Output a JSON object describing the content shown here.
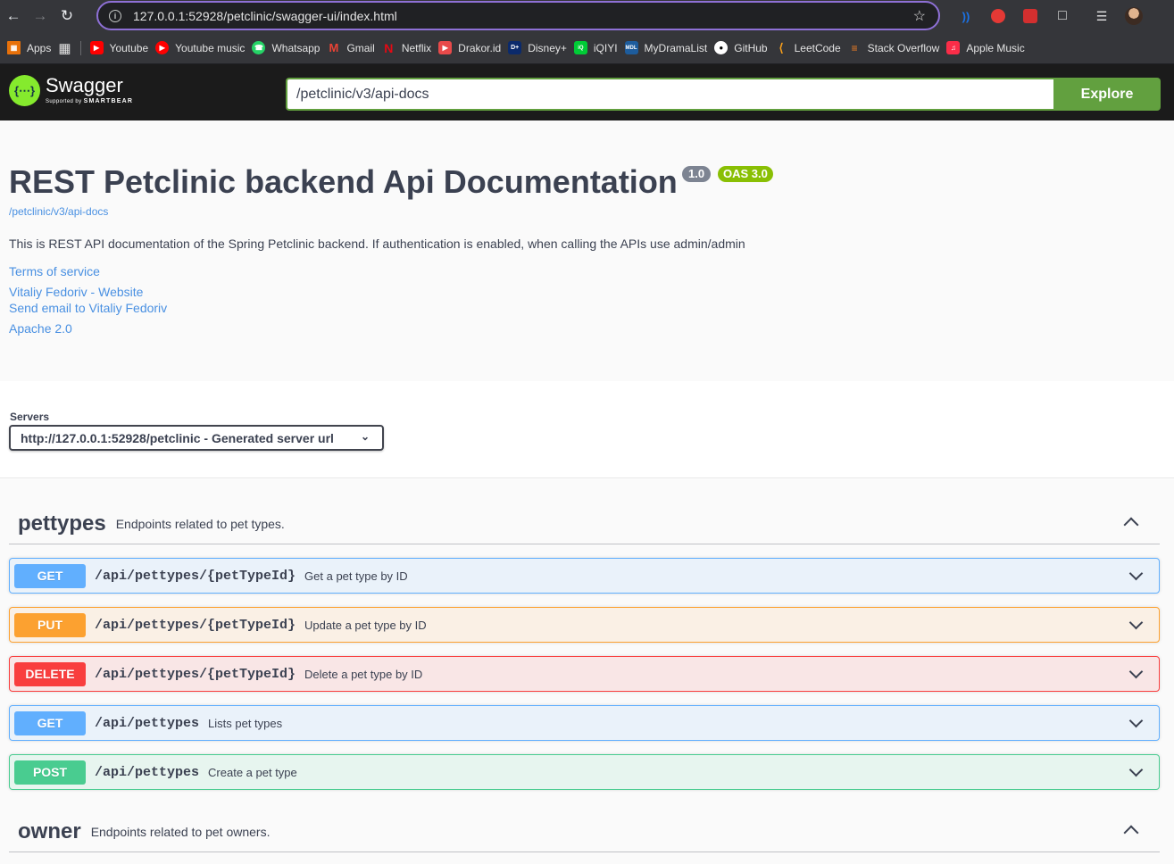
{
  "browser": {
    "url": "127.0.0.1:52928/petclinic/swagger-ui/index.html",
    "bookmarks": [
      {
        "label": "Apps",
        "icon": "apps-grid-icon",
        "color": "#e8710a"
      },
      {
        "label": "Youtube",
        "icon": "youtube-icon",
        "color": "#ff0000"
      },
      {
        "label": "Youtube music",
        "icon": "youtube-music-icon",
        "color": "#ff0000"
      },
      {
        "label": "Whatsapp",
        "icon": "whatsapp-icon",
        "color": "#25d366"
      },
      {
        "label": "Gmail",
        "icon": "gmail-icon",
        "color": "#ea4335"
      },
      {
        "label": "Netflix",
        "icon": "netflix-icon",
        "color": "#e50914"
      },
      {
        "label": "Drakor.id",
        "icon": "drakor-icon",
        "color": "#e84a4a"
      },
      {
        "label": "Disney+",
        "icon": "disney-icon",
        "color": "#0b2a6b"
      },
      {
        "label": "iQIYI",
        "icon": "iqiyi-icon",
        "color": "#00cc36"
      },
      {
        "label": "MyDramaList",
        "icon": "mydramalist-icon",
        "color": "#1d5c9c"
      },
      {
        "label": "GitHub",
        "icon": "github-icon",
        "color": "#ffffff"
      },
      {
        "label": "LeetCode",
        "icon": "leetcode-icon",
        "color": "#f89f1b"
      },
      {
        "label": "Stack Overflow",
        "icon": "stackoverflow-icon",
        "color": "#f48024"
      },
      {
        "label": "Apple Music",
        "icon": "apple-music-icon",
        "color": "#fa2d48"
      }
    ]
  },
  "topbar": {
    "logo_name": "Swagger",
    "logo_sub_prefix": "Supported by",
    "logo_sub_brand": "SMARTBEAR",
    "spec_url": "/petclinic/v3/api-docs",
    "explore_label": "Explore"
  },
  "info": {
    "title": "REST Petclinic backend Api Documentation",
    "version": "1.0",
    "oas": "OAS 3.0",
    "spec_link": "/petclinic/v3/api-docs",
    "description": "This is REST API documentation of the Spring Petclinic backend. If authentication is enabled, when calling the APIs use admin/admin",
    "links": {
      "terms": "Terms of service",
      "website": "Vitaliy Fedoriv - Website",
      "email": "Send email to Vitaliy Fedoriv",
      "license": "Apache 2.0"
    }
  },
  "servers": {
    "label": "Servers",
    "selected": "http://127.0.0.1:52928/petclinic - Generated server url"
  },
  "tags": [
    {
      "name": "pettypes",
      "description": "Endpoints related to pet types.",
      "operations": [
        {
          "method": "GET",
          "path": "/api/pettypes/{petTypeId}",
          "summary": "Get a pet type by ID"
        },
        {
          "method": "PUT",
          "path": "/api/pettypes/{petTypeId}",
          "summary": "Update a pet type by ID"
        },
        {
          "method": "DELETE",
          "path": "/api/pettypes/{petTypeId}",
          "summary": "Delete a pet type by ID"
        },
        {
          "method": "GET",
          "path": "/api/pettypes",
          "summary": "Lists pet types"
        },
        {
          "method": "POST",
          "path": "/api/pettypes",
          "summary": "Create a pet type"
        }
      ]
    },
    {
      "name": "owner",
      "description": "Endpoints related to pet owners."
    }
  ],
  "colors": {
    "get": "#61affe",
    "put": "#fca130",
    "delete": "#f93e3e",
    "post": "#49cc90",
    "explore": "#62a03f",
    "swagger_green": "#85ea2d"
  }
}
